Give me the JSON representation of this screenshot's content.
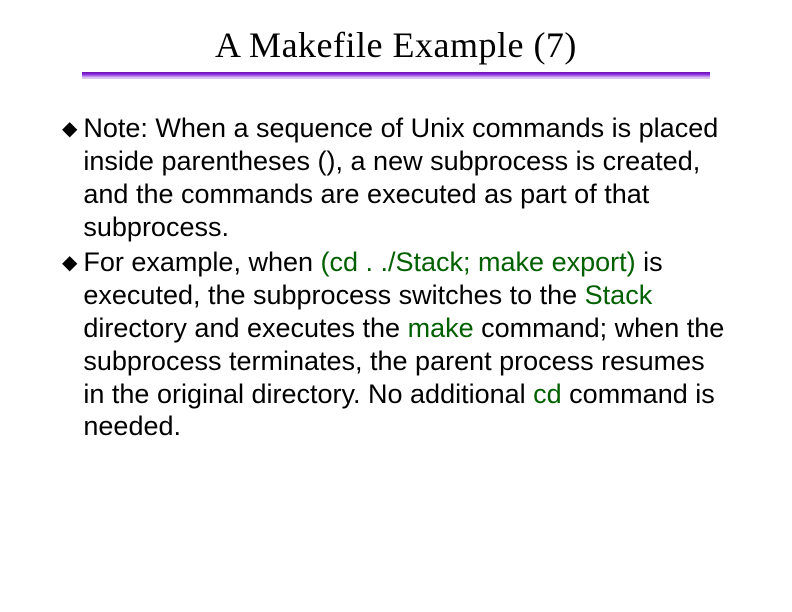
{
  "title": "A Makefile Example (7)",
  "bullets": [
    {
      "runs": [
        {
          "t": "Note: When a sequence of Unix commands is placed inside parentheses (), a new subprocess is created, and the commands are executed as part of that subprocess."
        }
      ]
    },
    {
      "runs": [
        {
          "t": "For example, when "
        },
        {
          "t": "(cd . ./Stack; make export)",
          "hl": true
        },
        {
          "t": " is executed, the subprocess switches to the "
        },
        {
          "t": "Stack",
          "hl": true
        },
        {
          "t": " directory and executes the "
        },
        {
          "t": "make",
          "hl": true
        },
        {
          "t": " command; when the subprocess terminates, the parent process resumes in the original directory. No additional "
        },
        {
          "t": "cd",
          "hl": true
        },
        {
          "t": " command is needed."
        }
      ]
    }
  ]
}
